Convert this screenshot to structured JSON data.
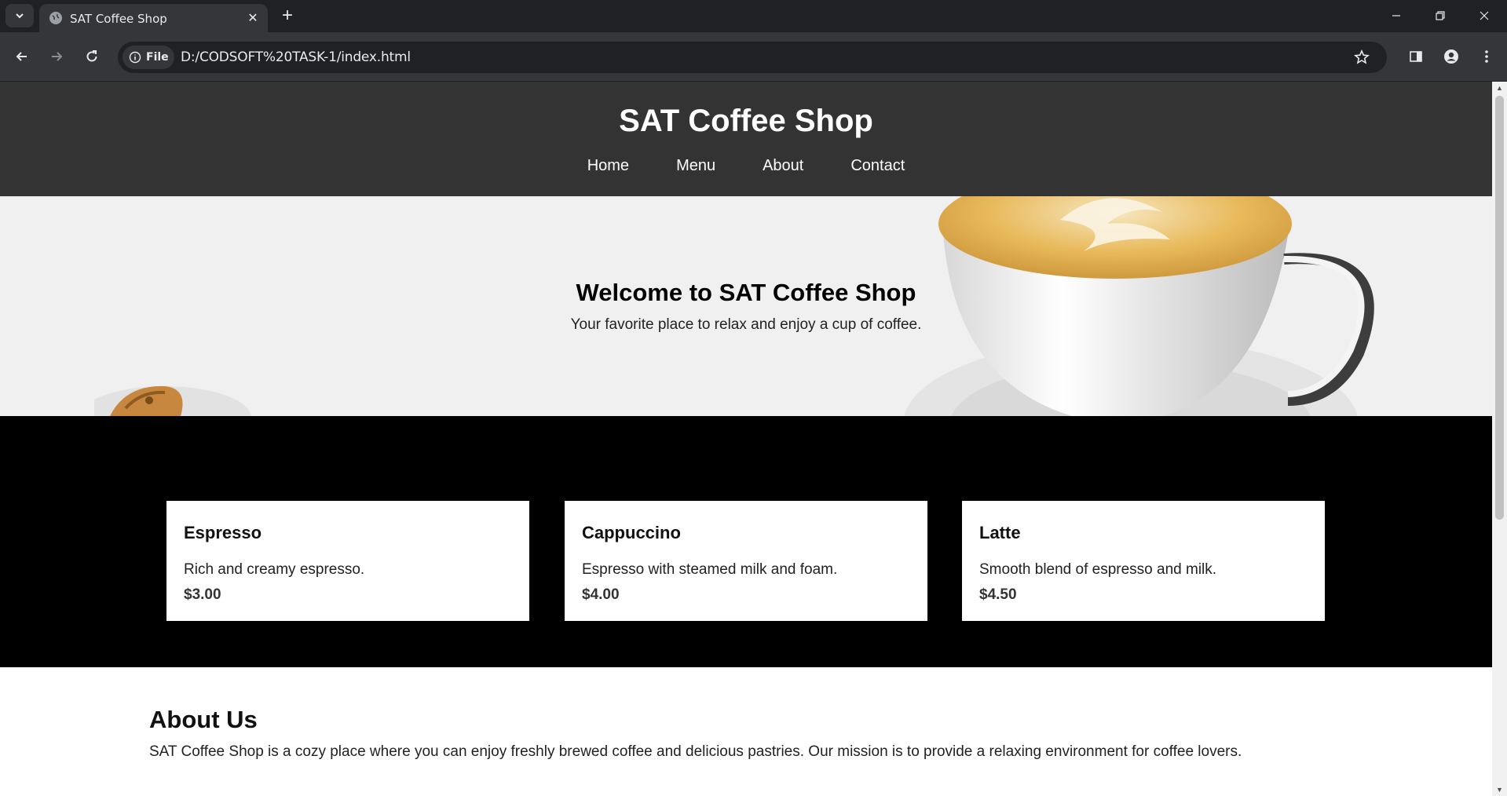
{
  "browser": {
    "tab_title": "SAT Coffee Shop",
    "chip_label": "File",
    "url": "D:/CODSOFT%20TASK-1/index.html"
  },
  "site": {
    "title": "SAT Coffee Shop",
    "nav": [
      "Home",
      "Menu",
      "About",
      "Contact"
    ]
  },
  "hero": {
    "title": "Welcome to SAT Coffee Shop",
    "subtitle": "Your favorite place to relax and enjoy a cup of coffee."
  },
  "menu": [
    {
      "name": "Espresso",
      "description": "Rich and creamy espresso.",
      "price": "$3.00"
    },
    {
      "name": "Cappuccino",
      "description": "Espresso with steamed milk and foam.",
      "price": "$4.00"
    },
    {
      "name": "Latte",
      "description": "Smooth blend of espresso and milk.",
      "price": "$4.50"
    }
  ],
  "about": {
    "title": "About Us",
    "text": "SAT Coffee Shop is a cozy place where you can enjoy freshly brewed coffee and delicious pastries. Our mission is to provide a relaxing environment for coffee lovers."
  },
  "colors": {
    "header_bg": "#333333",
    "menu_bg": "#000000",
    "hero_bg": "#f0f0f0"
  }
}
